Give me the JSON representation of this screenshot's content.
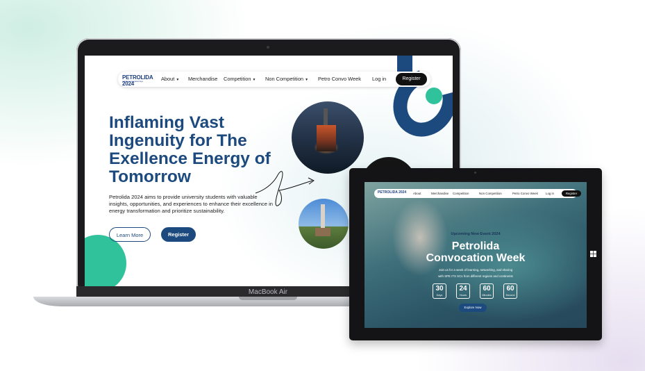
{
  "laptop": {
    "nav": {
      "logo_text": "PETROLIDA 2024",
      "logo_sub": "petroleum integrated days",
      "items": [
        {
          "label": "About",
          "dropdown": true
        },
        {
          "label": "Merchandise",
          "dropdown": false
        },
        {
          "label": "Competition",
          "dropdown": true
        },
        {
          "label": "Non Competition",
          "dropdown": true
        },
        {
          "label": "Petro Convo Week",
          "dropdown": false
        }
      ],
      "login": "Log in",
      "register": "Register"
    },
    "hero": {
      "title": "Inflaming Vast Ingenuity for The Exellence Energy of Tomorrow",
      "description": "Petrolida 2024 aims to provide university students with valuable insights, opportunities, and experiences to enhance their excellence in energy transformation and prioritize sustainability.",
      "learn_more": "Learn More",
      "register": "Register"
    },
    "device_label": "MacBook Air"
  },
  "tablet": {
    "nav": {
      "logo_text": "PETROLIDA 2024",
      "items": [
        "About",
        "Merchandise",
        "Competition",
        "Non Competition",
        "Petro Convo Week"
      ],
      "login": "Log in",
      "register": "Register"
    },
    "event_label": "Upcoming New Event 2024",
    "title_line1": "Petrolida",
    "title_line2": "Convocation Week",
    "desc_line1": "Join us for a week of learning, networking, and sharing",
    "desc_line2": "with SPE ITS SCs from different regions and continents",
    "countdown": [
      {
        "value": "30",
        "unit": "Days"
      },
      {
        "value": "24",
        "unit": "Hours"
      },
      {
        "value": "60",
        "unit": "Minutes"
      },
      {
        "value": "60",
        "unit": "Second"
      }
    ],
    "cta": "Explore Now"
  },
  "colors": {
    "brand_blue": "#1c4a7e",
    "teal": "#2fc29b",
    "dark": "#111111"
  }
}
